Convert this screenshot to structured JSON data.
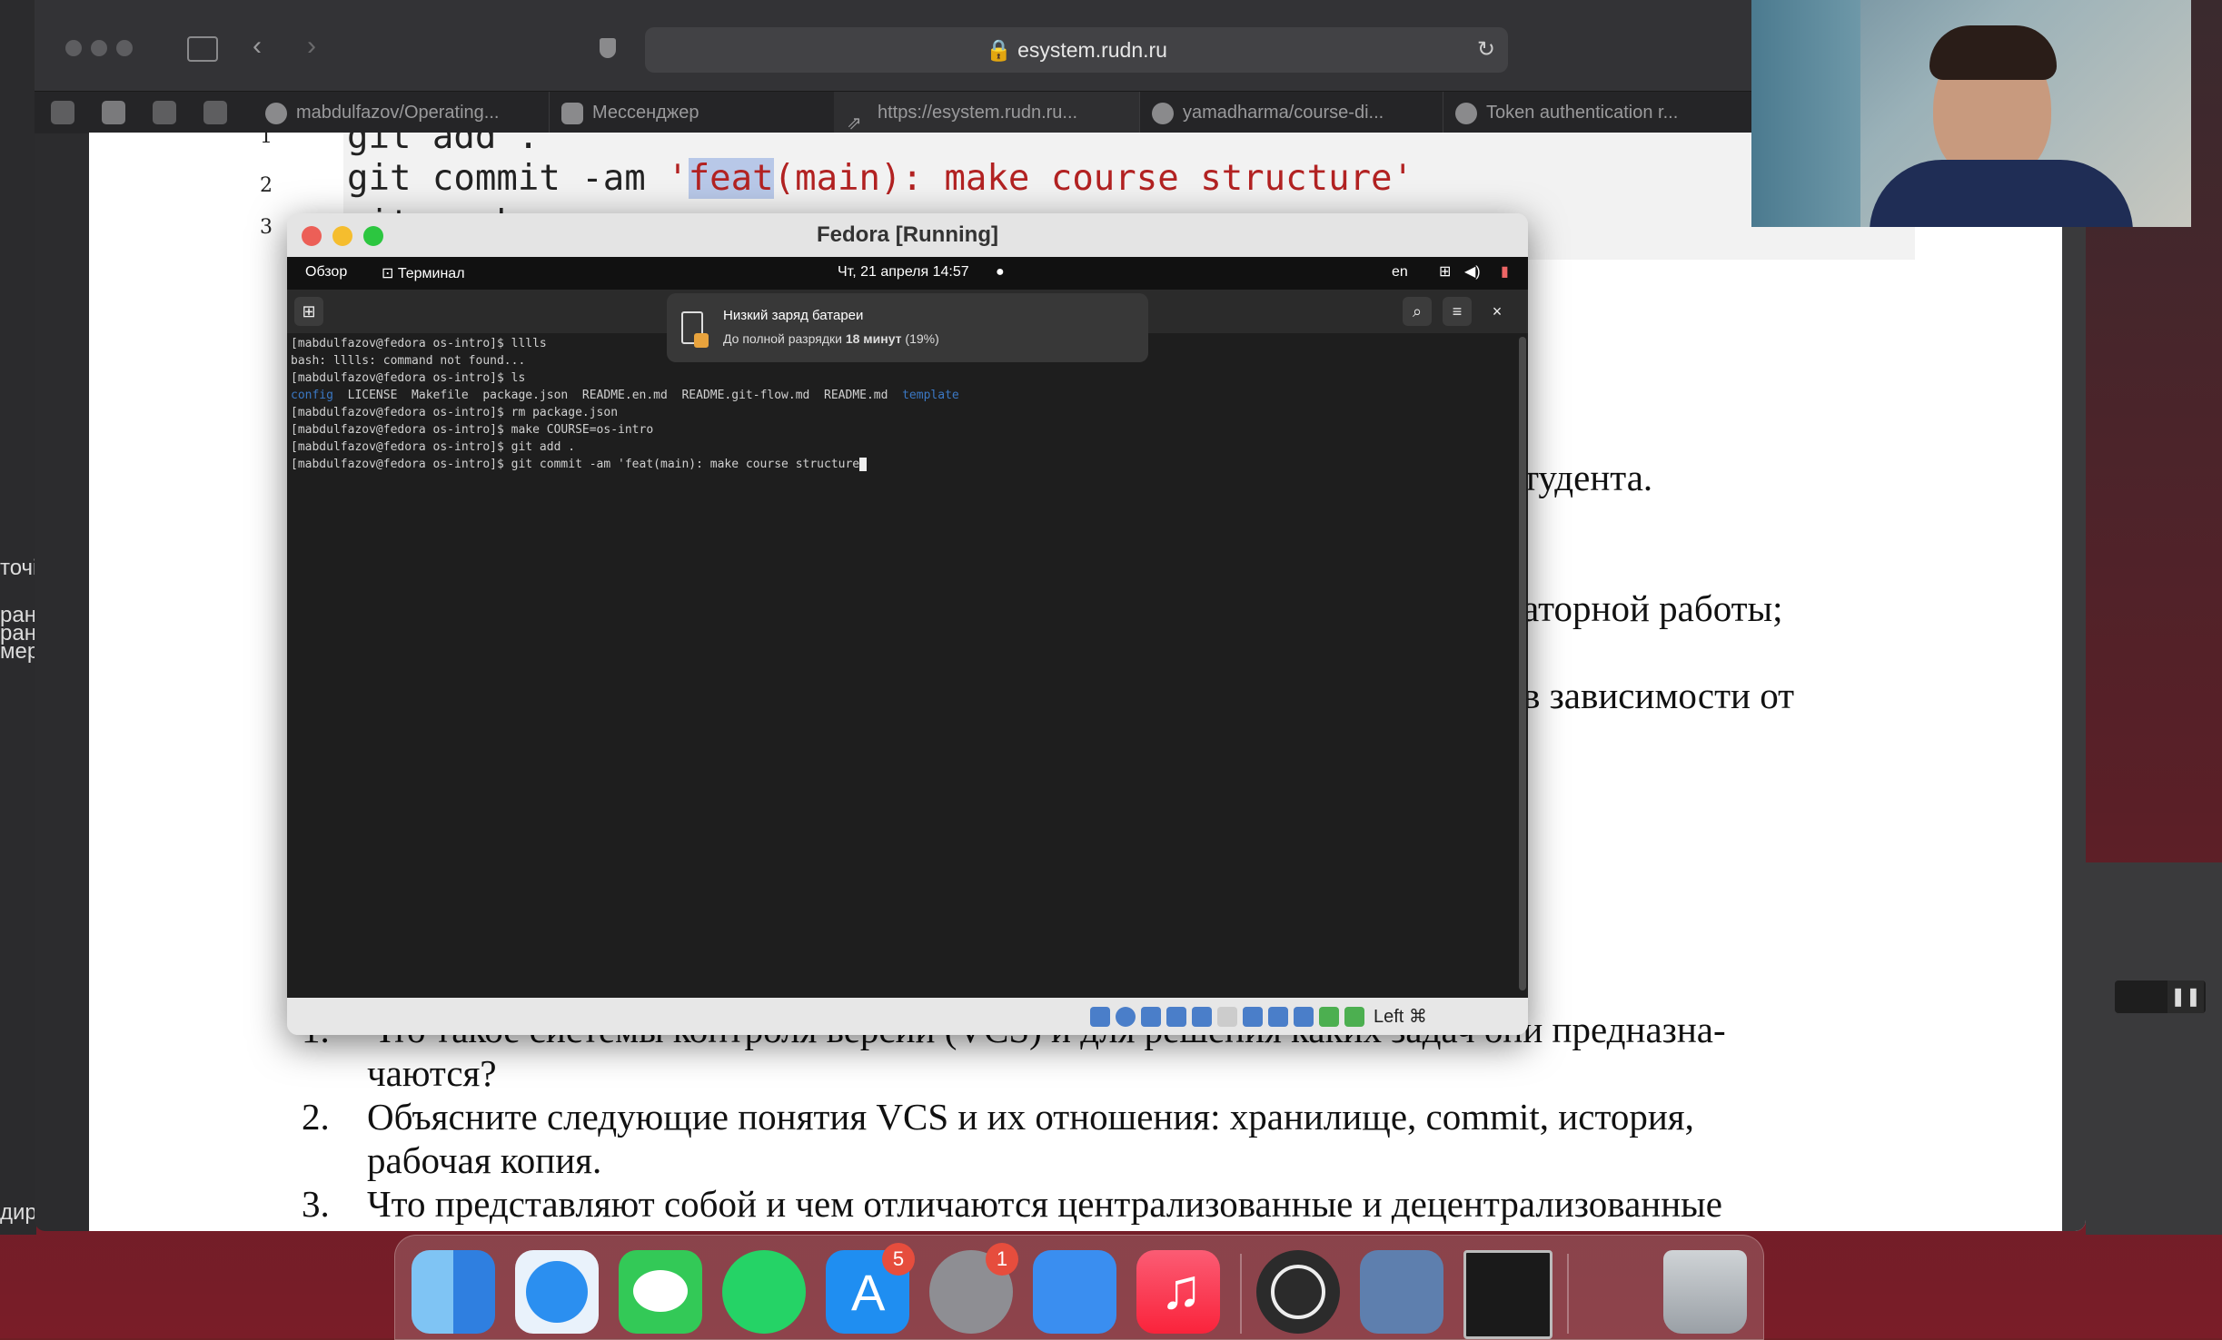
{
  "browser": {
    "url": "esystem.rudn.ru",
    "tabs": [
      {
        "label": "mabdulfazov/Operating..."
      },
      {
        "label": "Мессенджер"
      },
      {
        "label": "https://esystem.rudn.ru..."
      },
      {
        "label": "yamadharma/course-di..."
      },
      {
        "label": "Token authentication r..."
      }
    ]
  },
  "document": {
    "code_lines": {
      "n1": "1",
      "n2": "2",
      "n3": "3",
      "l1": "git add .",
      "l2_cmd": "git commit -am ",
      "l2_q": "'",
      "l2_hl": "feat",
      "l2_rest": "(main): make course structure'",
      "l3": "git push"
    },
    "fragments": {
      "f1": "тудента.",
      "f2": "аторной работы;",
      "f3": "в зависимости от"
    },
    "questions": [
      {
        "num": "1.",
        "line1": "Что такое системы контроля версий (VCS) и для решения каких задач они предназна-",
        "line2": "чаются?"
      },
      {
        "num": "2.",
        "line1": "Объясните следующие понятия VCS и их отношения: хранилище, commit, история,",
        "line2": "рабочая копия."
      },
      {
        "num": "3.",
        "line1": "Что представляют собой и чем отличаются централизованные и децентрализованные",
        "line2": ""
      }
    ]
  },
  "left_strip": {
    "t1": "точі",
    "t2": "ран",
    "t3": "ран",
    "t4": "мер",
    "t5": "дир"
  },
  "vbox": {
    "title": "Fedora [Running]",
    "gnome": {
      "overview": "Обзор",
      "app": "Терминал",
      "clock": "Чт, 21 апреля  14:57",
      "lang": "en"
    },
    "notification": {
      "title": "Низкий заряд батареи",
      "body_prefix": "До полной разрядки ",
      "body_bold": "18 минут",
      "body_suffix": " (19%)"
    },
    "terminal_lines": {
      "t1": "[mabdulfazov@fedora os-intro]$ lllls",
      "t2": "bash: lllls: command not found...",
      "t3": "[mabdulfazov@fedora os-intro]$ ls",
      "t4a": "config",
      "t4b": "  LICENSE  Makefile  package.json  README.en.md  README.git-flow.md  README.md  ",
      "t4c": "template",
      "t5": "[mabdulfazov@fedora os-intro]$ rm package.json",
      "t6": "[mabdulfazov@fedora os-intro]$ make COURSE=os-intro",
      "t7": "[mabdulfazov@fedora os-intro]$ git add .",
      "t8": "[mabdulfazov@fedora os-intro]$ git commit -am 'feat(main): make course structure"
    },
    "status_key": "Left ⌘"
  },
  "dock": {
    "badges": {
      "appstore": "5",
      "settings": "1"
    }
  },
  "colors": {
    "accent": "#4a7ec9",
    "string": "#b22222"
  }
}
